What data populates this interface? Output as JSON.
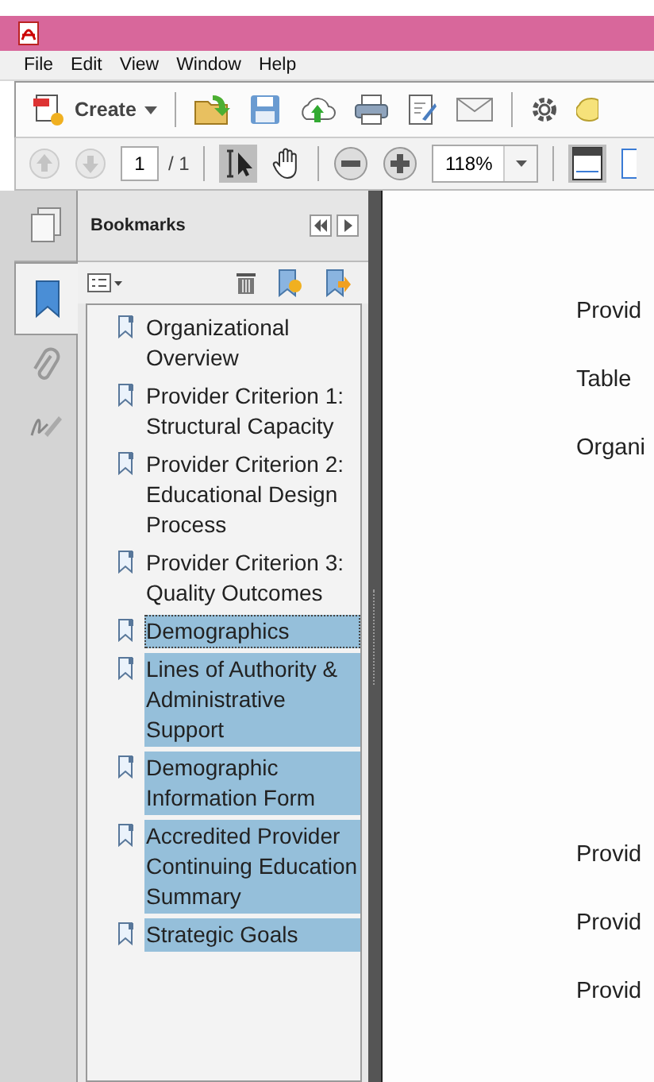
{
  "menu": [
    "File",
    "Edit",
    "View",
    "Window",
    "Help"
  ],
  "toolbar": {
    "create_label": "Create"
  },
  "nav": {
    "page": "1",
    "page_total": "/ 1",
    "zoom": "118%"
  },
  "bookmarks": {
    "title": "Bookmarks",
    "items": [
      {
        "label": "Organizational Overview",
        "selected": false,
        "focused": false
      },
      {
        "label": "Provider Criterion 1: Structural Capacity",
        "selected": false,
        "focused": false
      },
      {
        "label": "Provider Criterion 2: Educational Design Process",
        "selected": false,
        "focused": false
      },
      {
        "label": "Provider Criterion 3: Quality Outcomes",
        "selected": false,
        "focused": false
      },
      {
        "label": "Demographics",
        "selected": true,
        "focused": true
      },
      {
        "label": "Lines of Authority & Administrative Support",
        "selected": true,
        "focused": false
      },
      {
        "label": "Demographic Information Form",
        "selected": true,
        "focused": false
      },
      {
        "label": "Accredited Provider Continuing Education Summary",
        "selected": true,
        "focused": false
      },
      {
        "label": "Strategic Goals",
        "selected": true,
        "focused": false
      }
    ]
  },
  "document": {
    "lines_top": [
      "Provid",
      "Table",
      "Organi"
    ],
    "lines_bottom": [
      "Provid",
      "Provid",
      "Provid"
    ]
  }
}
